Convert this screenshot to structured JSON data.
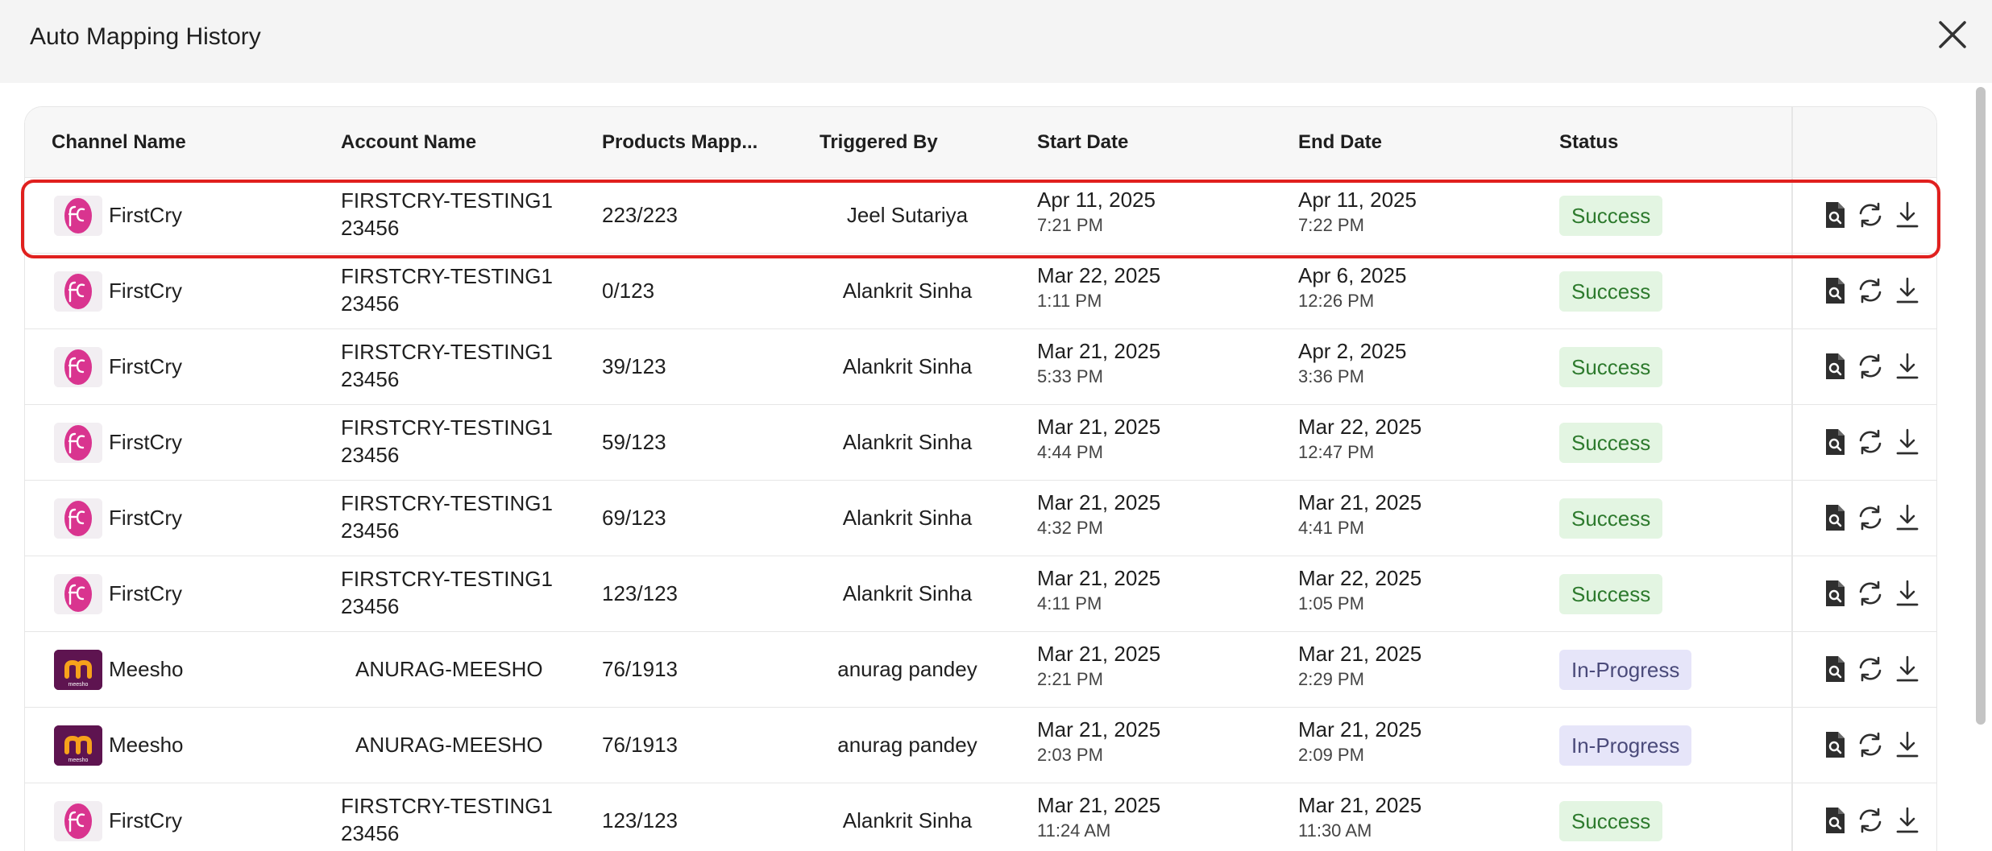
{
  "dialog": {
    "title": "Auto Mapping History"
  },
  "columns": {
    "channel": "Channel Name",
    "account": "Account Name",
    "products": "Products Mapp...",
    "triggered": "Triggered By",
    "start": "Start Date",
    "end": "End Date",
    "status": "Status"
  },
  "rows": [
    {
      "channel": "FirstCry",
      "logo": "firstcry-logo",
      "account_line1": "FIRSTCRY-TESTING1",
      "account_line2": "23456",
      "products": "223/223",
      "triggered": "Jeel Sutariya",
      "start_date": "Apr 11, 2025",
      "start_time": "7:21 PM",
      "end_date": "Apr 11, 2025",
      "end_time": "7:22 PM",
      "status": "Success"
    },
    {
      "channel": "FirstCry",
      "logo": "firstcry-logo",
      "account_line1": "FIRSTCRY-TESTING1",
      "account_line2": "23456",
      "products": "0/123",
      "triggered": "Alankrit Sinha",
      "start_date": "Mar 22, 2025",
      "start_time": "1:11 PM",
      "end_date": "Apr 6, 2025",
      "end_time": "12:26 PM",
      "status": "Success"
    },
    {
      "channel": "FirstCry",
      "logo": "firstcry-logo",
      "account_line1": "FIRSTCRY-TESTING1",
      "account_line2": "23456",
      "products": "39/123",
      "triggered": "Alankrit Sinha",
      "start_date": "Mar 21, 2025",
      "start_time": "5:33 PM",
      "end_date": "Apr 2, 2025",
      "end_time": "3:36 PM",
      "status": "Success"
    },
    {
      "channel": "FirstCry",
      "logo": "firstcry-logo",
      "account_line1": "FIRSTCRY-TESTING1",
      "account_line2": "23456",
      "products": "59/123",
      "triggered": "Alankrit Sinha",
      "start_date": "Mar 21, 2025",
      "start_time": "4:44 PM",
      "end_date": "Mar 22, 2025",
      "end_time": "12:47 PM",
      "status": "Success"
    },
    {
      "channel": "FirstCry",
      "logo": "firstcry-logo",
      "account_line1": "FIRSTCRY-TESTING1",
      "account_line2": "23456",
      "products": "69/123",
      "triggered": "Alankrit Sinha",
      "start_date": "Mar 21, 2025",
      "start_time": "4:32 PM",
      "end_date": "Mar 21, 2025",
      "end_time": "4:41 PM",
      "status": "Success"
    },
    {
      "channel": "FirstCry",
      "logo": "firstcry-logo",
      "account_line1": "FIRSTCRY-TESTING1",
      "account_line2": "23456",
      "products": "123/123",
      "triggered": "Alankrit Sinha",
      "start_date": "Mar 21, 2025",
      "start_time": "4:11 PM",
      "end_date": "Mar 22, 2025",
      "end_time": "1:05 PM",
      "status": "Success"
    },
    {
      "channel": "Meesho",
      "logo": "meesho-logo",
      "logo_text": "meesho",
      "account_line1": "ANURAG-MEESHO",
      "account_line2": "",
      "products": "76/1913",
      "triggered": "anurag pandey",
      "start_date": "Mar 21, 2025",
      "start_time": "2:21 PM",
      "end_date": "Mar 21, 2025",
      "end_time": "2:29 PM",
      "status": "In-Progress"
    },
    {
      "channel": "Meesho",
      "logo": "meesho-logo",
      "logo_text": "meesho",
      "account_line1": "ANURAG-MEESHO",
      "account_line2": "",
      "products": "76/1913",
      "triggered": "anurag pandey",
      "start_date": "Mar 21, 2025",
      "start_time": "2:03 PM",
      "end_date": "Mar 21, 2025",
      "end_time": "2:09 PM",
      "status": "In-Progress"
    },
    {
      "channel": "FirstCry",
      "logo": "firstcry-logo",
      "account_line1": "FIRSTCRY-TESTING1",
      "account_line2": "23456",
      "products": "123/123",
      "triggered": "Alankrit Sinha",
      "start_date": "Mar 21, 2025",
      "start_time": "11:24 AM",
      "end_date": "Mar 21, 2025",
      "end_time": "11:30 AM",
      "status": "Success"
    }
  ],
  "icons": {
    "close": "close-icon",
    "view": "view-report-icon",
    "retry": "refresh-icon",
    "download": "download-icon"
  },
  "colors": {
    "highlight": "#e0201e",
    "success_bg": "#e3f5e2",
    "success_text": "#2d7a2d",
    "progress_bg": "#e6e5f9",
    "firstcry_pink": "#d9348f",
    "meesho_purple": "#5e1450",
    "meesho_orange": "#f7a21b"
  }
}
